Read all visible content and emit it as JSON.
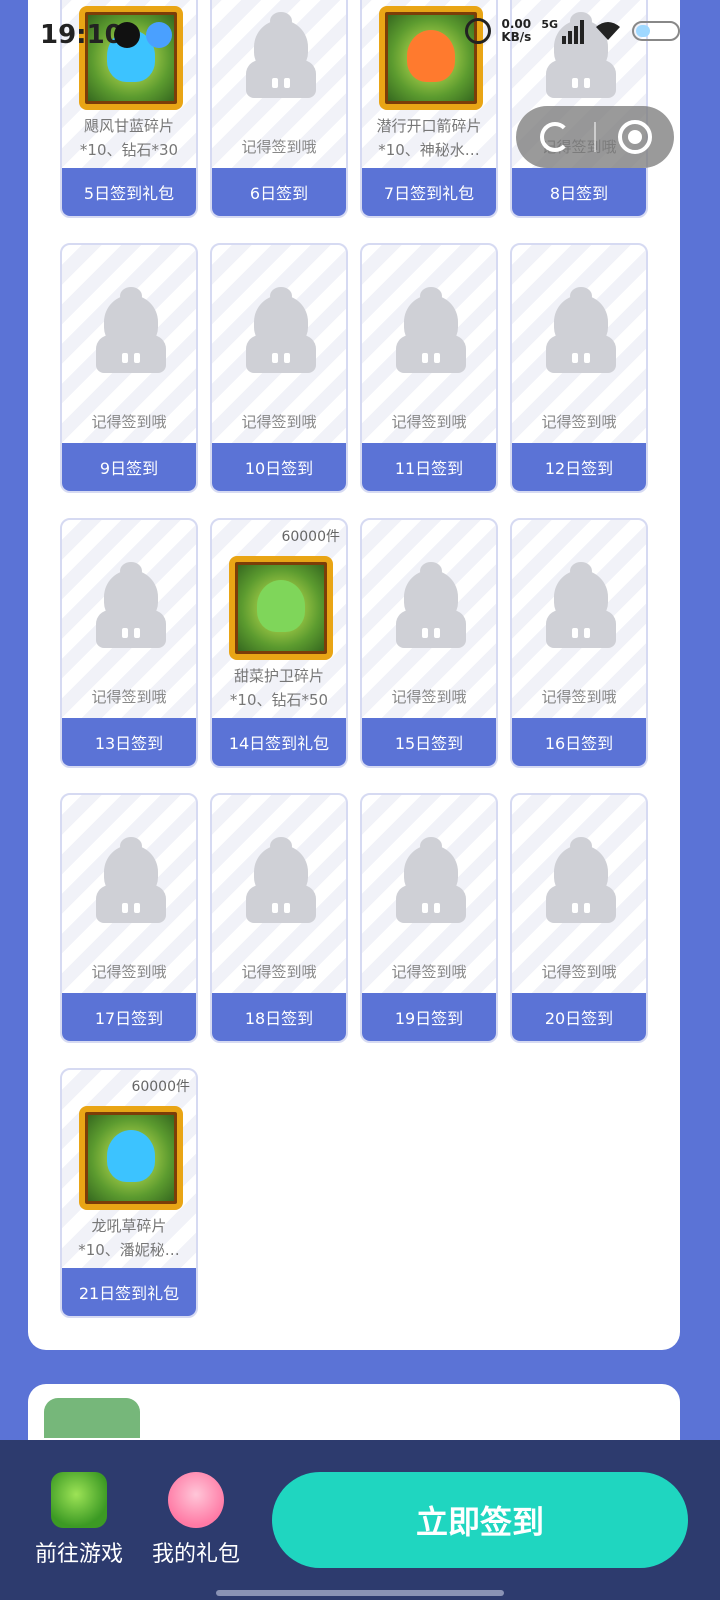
{
  "status_bar": {
    "time": "19:10",
    "net_speed_value": "0.00",
    "net_speed_unit": "KB/s",
    "network": "5G"
  },
  "rewards": [
    {
      "day_label": "5日签到礼包",
      "type": "reward",
      "item_line1": "飓风甘蓝碎片",
      "item_line2": "*10、钻石*30",
      "stock": ""
    },
    {
      "day_label": "6日签到",
      "type": "placeholder",
      "note": "记得签到哦"
    },
    {
      "day_label": "7日签到礼包",
      "type": "reward",
      "item_line1": "潜行开口箭碎片",
      "item_line2": "*10、神秘水…",
      "stock": ""
    },
    {
      "day_label": "8日签到",
      "type": "placeholder",
      "note": "记得签到哦"
    },
    {
      "day_label": "9日签到",
      "type": "placeholder",
      "note": "记得签到哦"
    },
    {
      "day_label": "10日签到",
      "type": "placeholder",
      "note": "记得签到哦"
    },
    {
      "day_label": "11日签到",
      "type": "placeholder",
      "note": "记得签到哦"
    },
    {
      "day_label": "12日签到",
      "type": "placeholder",
      "note": "记得签到哦"
    },
    {
      "day_label": "13日签到",
      "type": "placeholder",
      "note": "记得签到哦"
    },
    {
      "day_label": "14日签到礼包",
      "type": "reward",
      "item_line1": "甜菜护卫碎片",
      "item_line2": "*10、钻石*50",
      "stock": "60000件"
    },
    {
      "day_label": "15日签到",
      "type": "placeholder",
      "note": "记得签到哦"
    },
    {
      "day_label": "16日签到",
      "type": "placeholder",
      "note": "记得签到哦"
    },
    {
      "day_label": "17日签到",
      "type": "placeholder",
      "note": "记得签到哦"
    },
    {
      "day_label": "18日签到",
      "type": "placeholder",
      "note": "记得签到哦"
    },
    {
      "day_label": "19日签到",
      "type": "placeholder",
      "note": "记得签到哦"
    },
    {
      "day_label": "20日签到",
      "type": "placeholder",
      "note": "记得签到哦"
    },
    {
      "day_label": "21日签到礼包",
      "type": "reward",
      "item_line1": "龙吼草碎片",
      "item_line2": "*10、潘妮秘…",
      "stock": "60000件"
    }
  ],
  "bottom_bar": {
    "go_game_label": "前往游戏",
    "my_gifts_label": "我的礼包",
    "sign_now_label": "立即签到"
  },
  "colors": {
    "brand_blue": "#5b73d6",
    "sign_button": "#1fd6c0",
    "bottom_bar": "#2d3b6e"
  }
}
